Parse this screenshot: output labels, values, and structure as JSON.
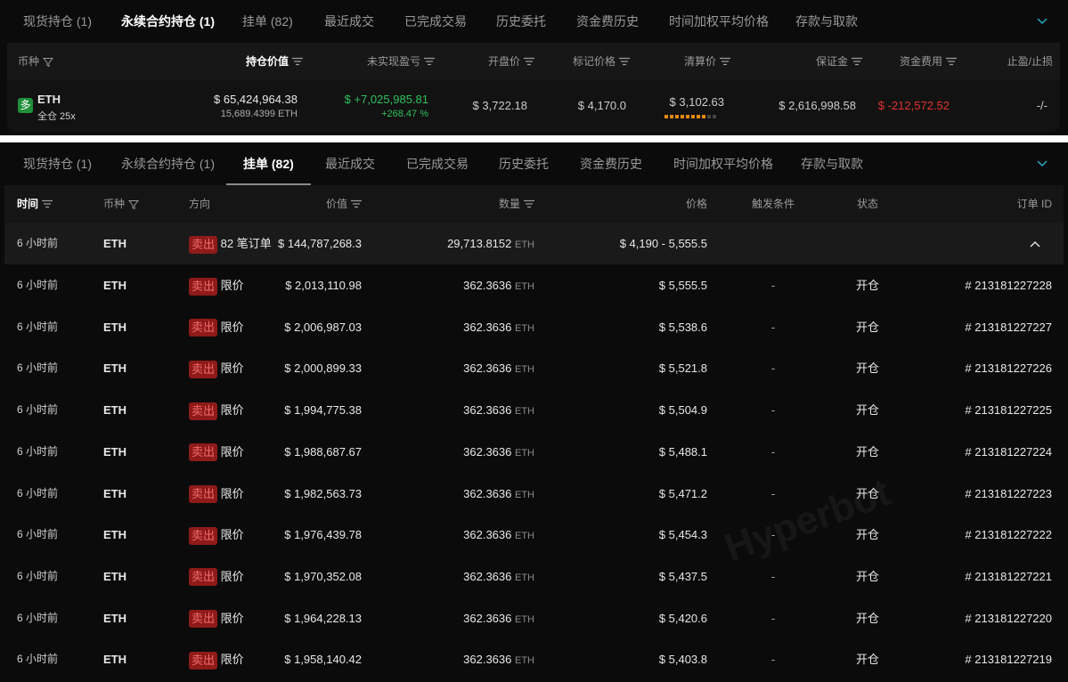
{
  "tabs": [
    {
      "label": "现货持仓 (1)"
    },
    {
      "label": "永续合约持仓 (1)"
    },
    {
      "label": "挂单 (82)"
    },
    {
      "label": "最近成交"
    },
    {
      "label": "已完成交易"
    },
    {
      "label": "历史委托"
    },
    {
      "label": "资金费历史"
    },
    {
      "label": "时间加权平均价格"
    },
    {
      "label": "存款与取款"
    }
  ],
  "positions": {
    "headers": {
      "coin": "币种",
      "value": "持仓价值",
      "pnl": "未实现盈亏",
      "entry": "开盘价",
      "mark": "标记价格",
      "liq": "清算价",
      "margin": "保证金",
      "funding": "资金费用",
      "tpsl": "止盈/止损"
    },
    "row": {
      "side_badge": "多",
      "coin": "ETH",
      "mode": "全仓 25x",
      "value": "$ 65,424,964.38",
      "size": "15,689.4399 ETH",
      "pnl": "$ +7,025,985.81",
      "pnl_pct": "+268.47 %",
      "entry": "$ 3,722.18",
      "mark": "$ 4,170.0",
      "liq": "$ 3,102.63",
      "liq_risk_level": 0.8,
      "margin": "$ 2,616,998.58",
      "funding": "$ -212,572.52",
      "tpsl": "-/-"
    }
  },
  "orders": {
    "headers": {
      "time": "时间",
      "coin": "币种",
      "direction": "方向",
      "value": "价值",
      "qty": "数量",
      "price": "价格",
      "trigger": "触发条件",
      "status": "状态",
      "id": "订单 ID"
    },
    "group": {
      "time": "6 小时前",
      "coin": "ETH",
      "side": "卖出",
      "type": "82 笔订单",
      "value": "$ 144,787,268.3",
      "qty": "29,713.8152",
      "unit": "ETH",
      "price": "$ 4,190 - 5,555.5"
    },
    "rows": [
      {
        "time": "6 小时前",
        "coin": "ETH",
        "side": "卖出",
        "type": "限价",
        "value": "$ 2,013,110.98",
        "qty": "362.3636",
        "unit": "ETH",
        "price": "$ 5,555.5",
        "trigger": "-",
        "status": "开仓",
        "id": "# 213181227228"
      },
      {
        "time": "6 小时前",
        "coin": "ETH",
        "side": "卖出",
        "type": "限价",
        "value": "$ 2,006,987.03",
        "qty": "362.3636",
        "unit": "ETH",
        "price": "$ 5,538.6",
        "trigger": "-",
        "status": "开仓",
        "id": "# 213181227227"
      },
      {
        "time": "6 小时前",
        "coin": "ETH",
        "side": "卖出",
        "type": "限价",
        "value": "$ 2,000,899.33",
        "qty": "362.3636",
        "unit": "ETH",
        "price": "$ 5,521.8",
        "trigger": "-",
        "status": "开仓",
        "id": "# 213181227226"
      },
      {
        "time": "6 小时前",
        "coin": "ETH",
        "side": "卖出",
        "type": "限价",
        "value": "$ 1,994,775.38",
        "qty": "362.3636",
        "unit": "ETH",
        "price": "$ 5,504.9",
        "trigger": "-",
        "status": "开仓",
        "id": "# 213181227225"
      },
      {
        "time": "6 小时前",
        "coin": "ETH",
        "side": "卖出",
        "type": "限价",
        "value": "$ 1,988,687.67",
        "qty": "362.3636",
        "unit": "ETH",
        "price": "$ 5,488.1",
        "trigger": "-",
        "status": "开仓",
        "id": "# 213181227224"
      },
      {
        "time": "6 小时前",
        "coin": "ETH",
        "side": "卖出",
        "type": "限价",
        "value": "$ 1,982,563.73",
        "qty": "362.3636",
        "unit": "ETH",
        "price": "$ 5,471.2",
        "trigger": "-",
        "status": "开仓",
        "id": "# 213181227223"
      },
      {
        "time": "6 小时前",
        "coin": "ETH",
        "side": "卖出",
        "type": "限价",
        "value": "$ 1,976,439.78",
        "qty": "362.3636",
        "unit": "ETH",
        "price": "$ 5,454.3",
        "trigger": "-",
        "status": "开仓",
        "id": "# 213181227222"
      },
      {
        "time": "6 小时前",
        "coin": "ETH",
        "side": "卖出",
        "type": "限价",
        "value": "$ 1,970,352.08",
        "qty": "362.3636",
        "unit": "ETH",
        "price": "$ 5,437.5",
        "trigger": "-",
        "status": "开仓",
        "id": "# 213181227221"
      },
      {
        "time": "6 小时前",
        "coin": "ETH",
        "side": "卖出",
        "type": "限价",
        "value": "$ 1,964,228.13",
        "qty": "362.3636",
        "unit": "ETH",
        "price": "$ 5,420.6",
        "trigger": "-",
        "status": "开仓",
        "id": "# 213181227220"
      },
      {
        "time": "6 小时前",
        "coin": "ETH",
        "side": "卖出",
        "type": "限价",
        "value": "$ 1,958,140.42",
        "qty": "362.3636",
        "unit": "ETH",
        "price": "$ 5,403.8",
        "trigger": "-",
        "status": "开仓",
        "id": "# 213181227219"
      }
    ]
  },
  "watermark": "Hyperbot",
  "colors": {
    "long": "#1f8f3a",
    "profit": "#2fc15b",
    "loss": "#e0332f",
    "sell": "#8e1a1a",
    "accent": "#2aa8c8"
  }
}
